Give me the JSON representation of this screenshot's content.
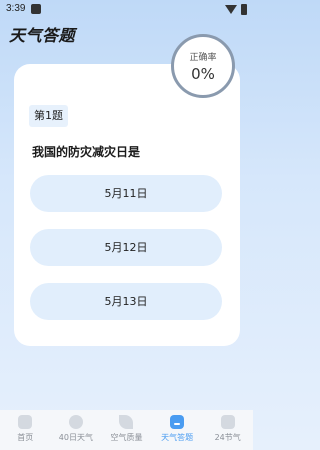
{
  "status": {
    "time": "3:39"
  },
  "app": {
    "title": "天气答题"
  },
  "accuracy": {
    "label": "正确率",
    "value": "0%"
  },
  "question": {
    "number": "第1题",
    "text": "我国的防灾减灾日是"
  },
  "options": [
    {
      "label": "5月11日"
    },
    {
      "label": "5月12日"
    },
    {
      "label": "5月13日"
    }
  ],
  "nav": [
    {
      "label": "首页",
      "icon": "home-icon"
    },
    {
      "label": "40日天气",
      "icon": "weather-icon"
    },
    {
      "label": "空气质量",
      "icon": "leaf-icon"
    },
    {
      "label": "天气答题",
      "icon": "quiz-icon",
      "active": true
    },
    {
      "label": "24节气",
      "icon": "solar-term-icon"
    }
  ],
  "colors": {
    "accent": "#4a9cf1",
    "option_bg": "#e1eefc"
  }
}
